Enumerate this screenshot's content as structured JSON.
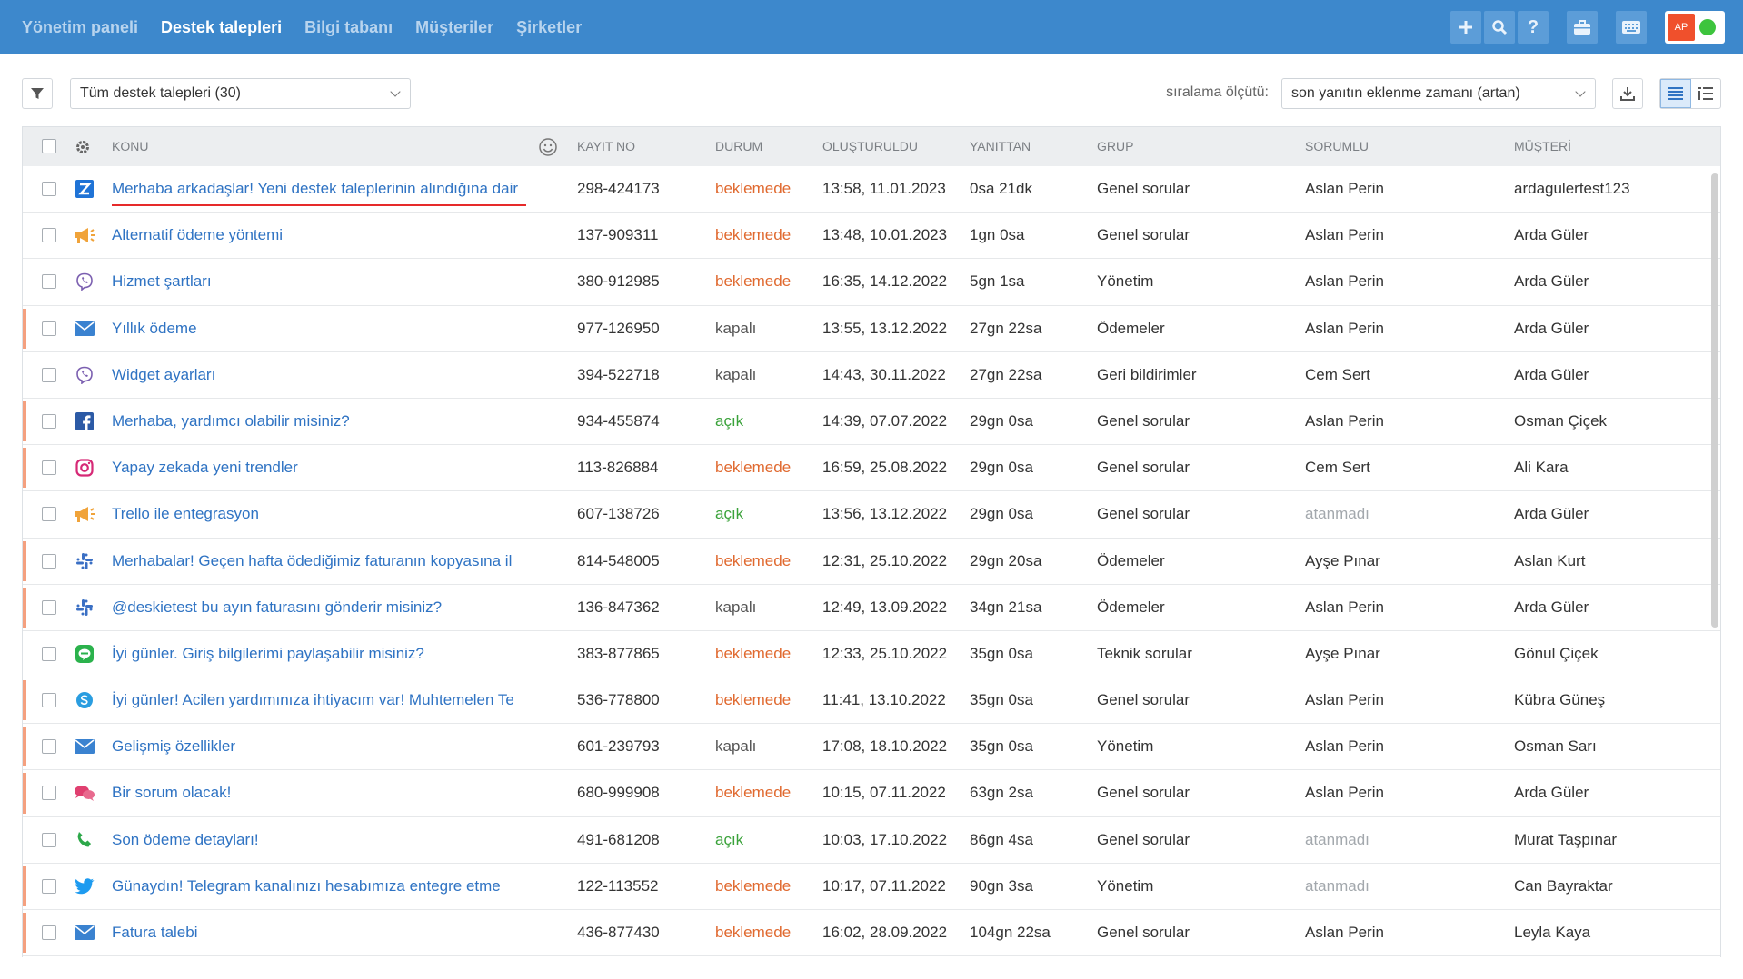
{
  "nav": {
    "items": [
      "Yönetim paneli",
      "Destek talepleri",
      "Bilgi tabanı",
      "Müşteriler",
      "Şirketler"
    ],
    "active_index": 1
  },
  "user": {
    "initials": "AP",
    "status_color": "#3dc43d"
  },
  "filter": {
    "selected": "Tüm destek talepleri (30)"
  },
  "sort": {
    "label": "sıralama ölçütü:",
    "selected": "son yanıtın eklenme zamanı (artan)"
  },
  "table": {
    "headers": {
      "subject": "KONU",
      "id": "KAYIT NO",
      "status": "DURUM",
      "created": "OLUŞTURULDU",
      "since": "YANITTAN",
      "group": "GRUP",
      "owner": "SORUMLU",
      "customer": "MÜŞTERİ"
    },
    "rows": [
      {
        "icon": "zendesk",
        "flag": false,
        "subject": "Merhaba arkadaşlar! Yeni destek taleplerinin alındığına dair",
        "id": "298-424173",
        "status": "beklemede",
        "status_key": "beklemede",
        "created": "13:58, 11.01.2023",
        "since": "0sa 21dk",
        "group": "Genel sorular",
        "owner": "Aslan Perin",
        "customer": "ardagulertest123"
      },
      {
        "icon": "megaphone",
        "flag": false,
        "subject": "Alternatif ödeme yöntemi",
        "id": "137-909311",
        "status": "beklemede",
        "status_key": "beklemede",
        "created": "13:48, 10.01.2023",
        "since": "1gn 0sa",
        "group": "Genel sorular",
        "owner": "Aslan Perin",
        "customer": "Arda Güler"
      },
      {
        "icon": "viber",
        "flag": false,
        "subject": "Hizmet şartları",
        "id": "380-912985",
        "status": "beklemede",
        "status_key": "beklemede",
        "created": "16:35, 14.12.2022",
        "since": "5gn 1sa",
        "group": "Yönetim",
        "owner": "Aslan Perin",
        "customer": "Arda Güler"
      },
      {
        "icon": "email",
        "flag": true,
        "subject": "Yıllık ödeme",
        "id": "977-126950",
        "status": "kapalı",
        "status_key": "kapali",
        "created": "13:55, 13.12.2022",
        "since": "27gn 22sa",
        "group": "Ödemeler",
        "owner": "Aslan Perin",
        "customer": "Arda Güler"
      },
      {
        "icon": "viber",
        "flag": false,
        "subject": "Widget ayarları",
        "id": "394-522718",
        "status": "kapalı",
        "status_key": "kapali",
        "created": "14:43, 30.11.2022",
        "since": "27gn 22sa",
        "group": "Geri bildirimler",
        "owner": "Cem Sert",
        "customer": "Arda Güler"
      },
      {
        "icon": "facebook",
        "flag": true,
        "subject": "Merhaba, yardımcı olabilir misiniz?",
        "id": "934-455874",
        "status": "açık",
        "status_key": "acik",
        "created": "14:39, 07.07.2022",
        "since": "29gn 0sa",
        "group": "Genel sorular",
        "owner": "Aslan Perin",
        "customer": "Osman Çiçek"
      },
      {
        "icon": "instagram",
        "flag": true,
        "subject": "Yapay zekada yeni trendler",
        "id": "113-826884",
        "status": "beklemede",
        "status_key": "beklemede",
        "created": "16:59, 25.08.2022",
        "since": "29gn 0sa",
        "group": "Genel sorular",
        "owner": "Cem Sert",
        "customer": "Ali Kara"
      },
      {
        "icon": "megaphone",
        "flag": false,
        "subject": "Trello ile entegrasyon",
        "id": "607-138726",
        "status": "açık",
        "status_key": "acik",
        "created": "13:56, 13.12.2022",
        "since": "29gn 0sa",
        "group": "Genel sorular",
        "owner": "atanmadı",
        "owner_unassigned": true,
        "customer": "Arda Güler"
      },
      {
        "icon": "slack",
        "flag": true,
        "subject": "Merhabalar! Geçen hafta ödediğimiz faturanın kopyasına il",
        "id": "814-548005",
        "status": "beklemede",
        "status_key": "beklemede",
        "created": "12:31, 25.10.2022",
        "since": "29gn 20sa",
        "group": "Ödemeler",
        "owner": "Ayşe Pınar",
        "customer": "Aslan Kurt"
      },
      {
        "icon": "slack",
        "flag": true,
        "subject": "@deskietest bu ayın faturasını gönderir misiniz?",
        "id": "136-847362",
        "status": "kapalı",
        "status_key": "kapali",
        "created": "12:49, 13.09.2022",
        "since": "34gn 21sa",
        "group": "Ödemeler",
        "owner": "Aslan Perin",
        "customer": "Arda Güler"
      },
      {
        "icon": "line",
        "flag": false,
        "subject": "İyi günler. Giriş bilgilerimi paylaşabilir misiniz?",
        "id": "383-877865",
        "status": "beklemede",
        "status_key": "beklemede",
        "created": "12:33, 25.10.2022",
        "since": "35gn 0sa",
        "group": "Teknik sorular",
        "owner": "Ayşe Pınar",
        "customer": "Gönul Çiçek"
      },
      {
        "icon": "skype",
        "flag": true,
        "subject": "İyi günler! Acilen yardımınıza ihtiyacım var! Muhtemelen Te",
        "id": "536-778800",
        "status": "beklemede",
        "status_key": "beklemede",
        "created": "11:41, 13.10.2022",
        "since": "35gn 0sa",
        "group": "Genel sorular",
        "owner": "Aslan Perin",
        "customer": "Kübra Güneş"
      },
      {
        "icon": "email",
        "flag": true,
        "subject": "Gelişmiş özellikler",
        "id": "601-239793",
        "status": "kapalı",
        "status_key": "kapali",
        "created": "17:08, 18.10.2022",
        "since": "35gn 0sa",
        "group": "Yönetim",
        "owner": "Aslan Perin",
        "customer": "Osman Sarı"
      },
      {
        "icon": "chat",
        "flag": true,
        "subject": "Bir sorum olacak!",
        "id": "680-999908",
        "status": "beklemede",
        "status_key": "beklemede",
        "created": "10:15, 07.11.2022",
        "since": "63gn 2sa",
        "group": "Genel sorular",
        "owner": "Aslan Perin",
        "customer": "Arda Güler"
      },
      {
        "icon": "phone",
        "flag": false,
        "subject": "Son ödeme detayları!",
        "id": "491-681208",
        "status": "açık",
        "status_key": "acik",
        "created": "10:03, 17.10.2022",
        "since": "86gn 4sa",
        "group": "Genel sorular",
        "owner": "atanmadı",
        "owner_unassigned": true,
        "customer": "Murat Taşpınar"
      },
      {
        "icon": "twitter",
        "flag": true,
        "subject": "Günaydın! Telegram kanalınızı hesabımıza entegre etme",
        "id": "122-113552",
        "status": "beklemede",
        "status_key": "beklemede",
        "created": "10:17, 07.11.2022",
        "since": "90gn 3sa",
        "group": "Yönetim",
        "owner": "atanmadı",
        "owner_unassigned": true,
        "customer": "Can Bayraktar"
      },
      {
        "icon": "email",
        "flag": true,
        "subject": "Fatura talebi",
        "id": "436-877430",
        "status": "beklemede",
        "status_key": "beklemede",
        "created": "16:02, 28.09.2022",
        "since": "104gn 22sa",
        "group": "Genel sorular",
        "owner": "Aslan Perin",
        "customer": "Leyla Kaya"
      }
    ]
  }
}
